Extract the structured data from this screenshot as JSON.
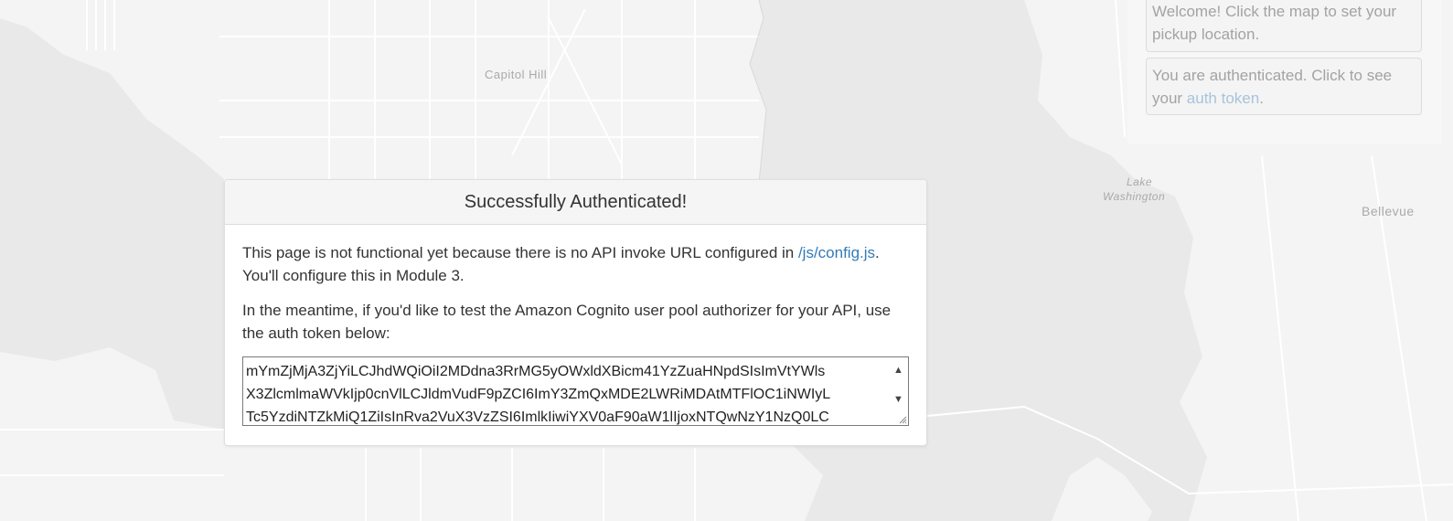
{
  "map": {
    "labels": {
      "capitol_hill": "Capitol Hill",
      "lake": "Lake",
      "washington": "Washington",
      "bellevue": "Bellevue"
    },
    "colors": {
      "land": "#f4f4f4",
      "water": "#e9e9ea",
      "roads": "#ffffff"
    }
  },
  "messages": [
    {
      "text_before": "Welcome! Click the map to set your pickup location.",
      "link": "",
      "text_after": ""
    },
    {
      "text_before": "You are authenticated. Click to see your ",
      "link": "auth token",
      "text_after": "."
    }
  ],
  "modal": {
    "title": "Successfully Authenticated!",
    "para1_before": "This page is not functional yet because there is no API invoke URL configured in ",
    "para1_link": "/js/config.js",
    "para1_after": ". You'll configure this in Module 3.",
    "para2": "In the meantime, if you'd like to test the Amazon Cognito user pool authorizer for your API, use the auth token below:",
    "token_lines": [
      "mYmZjMjA3ZjYiLCJhdWQiOiI2MDdna3RrMG5yOWxldXBicm41YzZuaHNpdSIsImVtYWls",
      "X3ZlcmlmaWVkIjp0cnVlLCJldmVudF9pZCI6ImY3ZmQxMDE2LWRiMDAtMTFlOC1iNWIyL",
      "Tc5YzdiNTZkMiQ1ZiIsInRva2VuX3VzZSI6ImlkIiwiYXV0aF90aW1lIjoxNTQwNzY1NzQ0LC"
    ]
  }
}
